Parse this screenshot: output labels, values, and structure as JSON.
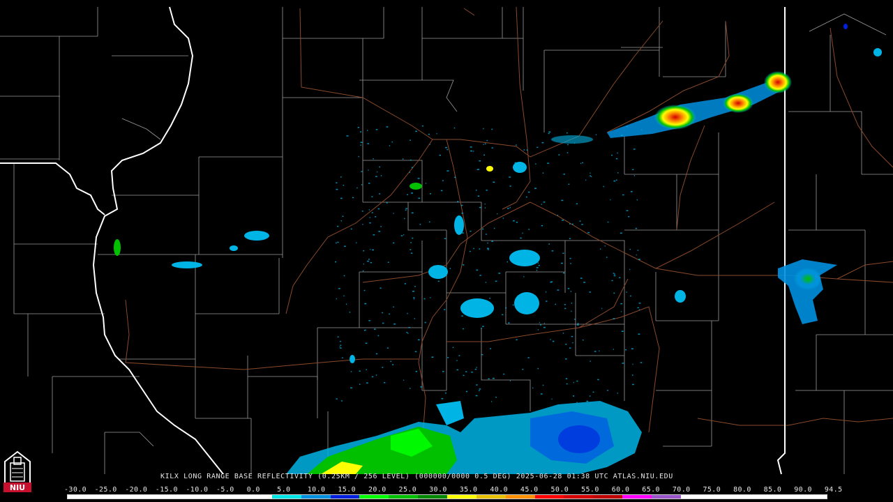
{
  "product": {
    "station": "KILX",
    "description": "KILX LONG RANGE BASE REFLECTIVITY (0.25KM / 256 LEVEL) (000000/0000 0.5 DEG) 2025-06-28 01:38 UTC  ATLAS.NIU.EDU"
  },
  "logo": {
    "text": "NIU",
    "colors": {
      "red": "#c8102e",
      "white": "#ffffff"
    }
  },
  "scale": {
    "labels": [
      "-30.0",
      "-25.0",
      "-20.0",
      "-15.0",
      "-10.0",
      "-5.0",
      "0.0",
      "5.0",
      "10.0",
      "15.0",
      "20.0",
      "25.0",
      "30.0",
      "35.0",
      "40.0",
      "45.0",
      "50.0",
      "55.0",
      "60.0",
      "65.0",
      "70.0",
      "75.0",
      "80.0",
      "85.0",
      "90.0",
      "94.5"
    ],
    "colors": [
      "#ffffff",
      "#ffffff",
      "#ffffff",
      "#ffffff",
      "#ffffff",
      "#ffffff",
      "#ffffff",
      "#00e5e5",
      "#0090e0",
      "#0020e0",
      "#00ff00",
      "#00c000",
      "#008800",
      "#ffff00",
      "#e7c000",
      "#ff9000",
      "#ff0000",
      "#d60000",
      "#c00000",
      "#ff00ff",
      "#9955c9",
      "#ffffff",
      "#ffffff",
      "#ffffff",
      "#ffffff",
      "#ffffff"
    ]
  },
  "map_colors": {
    "state_border": "#ffffff",
    "county_border": "#9a9a9a",
    "highway": "#8a4a2a"
  }
}
